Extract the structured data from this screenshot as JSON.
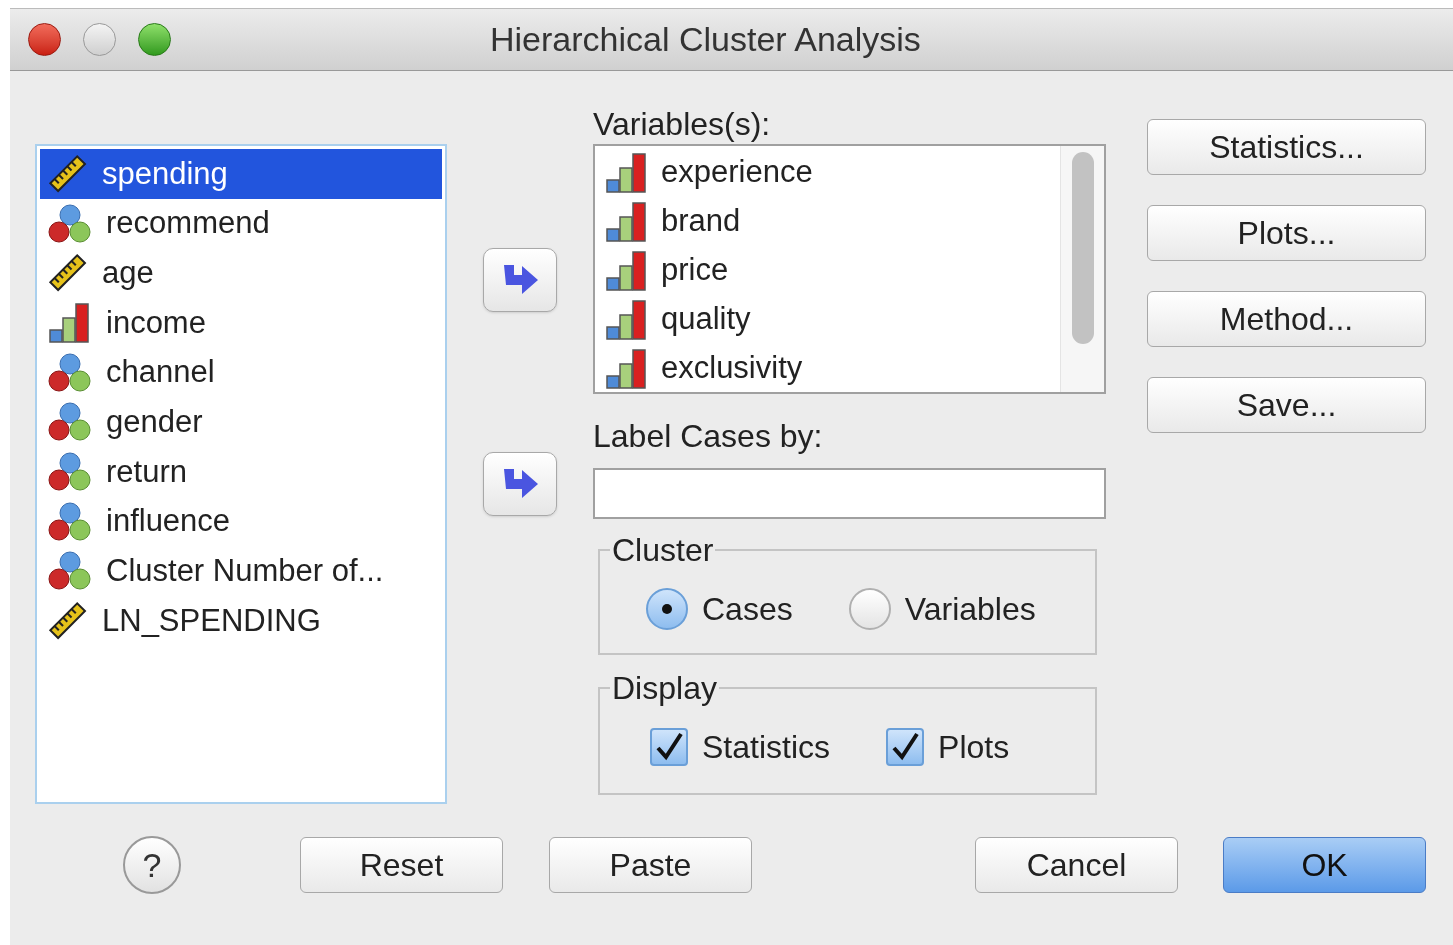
{
  "window": {
    "title": "Hierarchical Cluster Analysis"
  },
  "source_list": {
    "items": [
      {
        "label": "spending",
        "kind": "scale",
        "selected": true
      },
      {
        "label": "recommend",
        "kind": "nominal",
        "selected": false
      },
      {
        "label": "age",
        "kind": "scale",
        "selected": false
      },
      {
        "label": "income",
        "kind": "ordinal",
        "selected": false
      },
      {
        "label": "channel",
        "kind": "nominal",
        "selected": false
      },
      {
        "label": "gender",
        "kind": "nominal",
        "selected": false
      },
      {
        "label": "return",
        "kind": "nominal",
        "selected": false
      },
      {
        "label": "influence",
        "kind": "nominal",
        "selected": false
      },
      {
        "label": "Cluster Number of...",
        "kind": "nominal",
        "selected": false
      },
      {
        "label": "LN_SPENDING",
        "kind": "scale",
        "selected": false
      }
    ]
  },
  "variables": {
    "label": "Variables(s):",
    "items": [
      {
        "label": "experience",
        "kind": "ordinal"
      },
      {
        "label": "brand",
        "kind": "ordinal"
      },
      {
        "label": "price",
        "kind": "ordinal"
      },
      {
        "label": "quality",
        "kind": "ordinal"
      },
      {
        "label": "exclusivity",
        "kind": "ordinal"
      }
    ]
  },
  "label_cases": {
    "label": "Label Cases by:"
  },
  "cluster": {
    "title": "Cluster",
    "options": [
      {
        "label": "Cases",
        "selected": true
      },
      {
        "label": "Variables",
        "selected": false
      }
    ]
  },
  "display": {
    "title": "Display",
    "options": [
      {
        "label": "Statistics",
        "checked": true
      },
      {
        "label": "Plots",
        "checked": true
      }
    ]
  },
  "side_buttons": [
    "Statistics...",
    "Plots...",
    "Method...",
    "Save..."
  ],
  "help": "?",
  "buttons": [
    {
      "label": "Reset",
      "default": false
    },
    {
      "label": "Paste",
      "default": false
    },
    {
      "label": "Cancel",
      "default": false
    },
    {
      "label": "OK",
      "default": true
    }
  ]
}
